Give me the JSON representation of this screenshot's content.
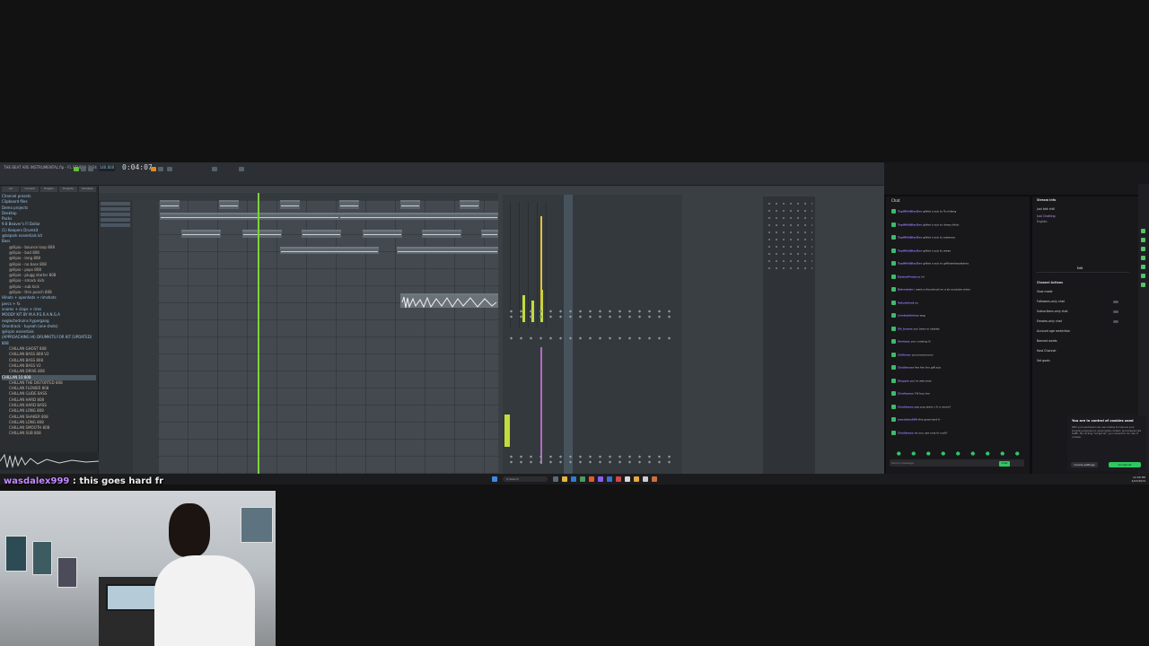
{
  "fl_studio": {
    "title": "THE BEAT ARE INSTRUMENTAL.flp - FL STUDIO 2024",
    "time": "0:04:07",
    "bpm": "140.000",
    "browser_tabs": [
      "All",
      "Current",
      "Plugins",
      "Projects",
      "Samples"
    ],
    "browser_items": [
      {
        "label": "Channel presets",
        "kind": "folder"
      },
      {
        "label": "Clipboard files",
        "kind": "folder"
      },
      {
        "label": "Demo projects",
        "kind": "folder"
      },
      {
        "label": "Desktop",
        "kind": "folder"
      },
      {
        "label": "Packs",
        "kind": "folder"
      },
      {
        "label": "9.8 Beaver's Fl Dollar",
        "kind": "folder"
      },
      {
        "label": "(1) Keepers Drumkit",
        "kind": "folder"
      },
      {
        "label": "@lolpark essentials kit",
        "kind": "folder"
      },
      {
        "label": "Bass",
        "kind": "folder"
      },
      {
        "label": "@lilpio - bounce loop 808",
        "kind": "sub"
      },
      {
        "label": "@lilpio - bad 808",
        "kind": "sub"
      },
      {
        "label": "@lilpio - long 808",
        "kind": "sub"
      },
      {
        "label": "@lilpio - no bass 808",
        "kind": "sub"
      },
      {
        "label": "@lilpio - pops 808",
        "kind": "sub"
      },
      {
        "label": "@lilpio - plugg starter 808",
        "kind": "sub"
      },
      {
        "label": "@lilpio - smack kick",
        "kind": "sub"
      },
      {
        "label": "@lilpio - sub kick",
        "kind": "sub"
      },
      {
        "label": "@lilpio - thin punch 808",
        "kind": "sub"
      },
      {
        "label": "Hihats + openhats + rimshots",
        "kind": "folder"
      },
      {
        "label": "percs + fx",
        "kind": "folder"
      },
      {
        "label": "snares + claps + rims",
        "kind": "folder"
      },
      {
        "label": "MOODY KIT BY M.A.P.S.R.A.N.G.A",
        "kind": "folder"
      },
      {
        "label": "neglectedruins hypergang",
        "kind": "folder"
      },
      {
        "label": "Omnitrack - tuyeah (one shots)",
        "kind": "folder"
      },
      {
        "label": "@ilspin essentials",
        "kind": "folder"
      },
      {
        "label": "(APPROACHING HI) DRUMKITS FOR KIT [UPDATED]",
        "kind": "folder"
      },
      {
        "label": "808",
        "kind": "folder"
      },
      {
        "label": "CHILLAN GHOST 808",
        "kind": "sub"
      },
      {
        "label": "CHILLAN BASS 808 V2",
        "kind": "sub"
      },
      {
        "label": "CHILLAN BASS 808",
        "kind": "sub"
      },
      {
        "label": "CHILLAN BASS V2",
        "kind": "sub"
      },
      {
        "label": "CHILLAN DRIVE 808",
        "kind": "sub"
      },
      {
        "label": "CHILLAN 10 808",
        "kind": "hl"
      },
      {
        "label": "CHILLAN THE DISTORTED 808",
        "kind": "sub"
      },
      {
        "label": "CHILLAN FLOWER 808",
        "kind": "sub"
      },
      {
        "label": "CHILLAN GLIDE BASS",
        "kind": "sub"
      },
      {
        "label": "CHILLAN HARD 808",
        "kind": "sub"
      },
      {
        "label": "CHILLAN HARD BASS",
        "kind": "sub"
      },
      {
        "label": "CHILLAN LONG 808",
        "kind": "sub"
      },
      {
        "label": "CHILLAN SHAKER 808",
        "kind": "sub"
      },
      {
        "label": "CHILLAN LONG 808",
        "kind": "sub"
      },
      {
        "label": "CHILLAN SMOOTH 808",
        "kind": "sub"
      },
      {
        "label": "CHILLAN SUB 808",
        "kind": "sub"
      }
    ]
  },
  "twitch": {
    "chat_title": "Chat",
    "messages": [
      {
        "user": "TopWithBlacDev",
        "text": "gifted a sub to Tuchilang"
      },
      {
        "user": "TopWithBlacDev",
        "text": "gifted a sub to dmsuchkdo"
      },
      {
        "user": "TopWithBlacDev",
        "text": "gifted a sub to justwrya"
      },
      {
        "user": "TopWithBlacDev",
        "text": "gifted a sub to weee"
      },
      {
        "user": "TopWithBlacDev",
        "text": "gifted a sub to gifthisedassistants"
      },
      {
        "user": "DylansProduce",
        "text": "lol"
      },
      {
        "user": "Bahndrain",
        "text": "i want a thumbnail on a sh youtube video"
      },
      {
        "user": "Valueblunt",
        "text": "yo"
      },
      {
        "user": "Livebubblelux",
        "text": "wsg"
      },
      {
        "user": "Oh_bonne",
        "text": "you been in labbbb"
      },
      {
        "user": "Ventnav",
        "text": "you cooking lil"
      },
      {
        "user": "Chillsvar",
        "text": "yoooooooooooo"
      },
      {
        "user": "Chullanoar",
        "text": "the fan trio gift sub"
      },
      {
        "user": "Sluppin",
        "text": "you're welcome"
      },
      {
        "user": "Chullamax",
        "text": "YW boy bro"
      },
      {
        "user": "Chullamax",
        "text": "pop pop were u fr a neuro?"
      },
      {
        "user": "wasdalex999",
        "text": "this goes hard fr"
      },
      {
        "user": "Chullamax",
        "text": "do you use only to rush?"
      }
    ],
    "input_placeholder": "Send a message",
    "chat_button": "Chat",
    "info": {
      "title": "Stream Info",
      "subtitle": "just talk chill",
      "category": "Just Chatting",
      "tag": "English",
      "edit_label": "Edit",
      "actions_title": "Channel Actions",
      "actions": [
        "Slow mode",
        "Followers-only chat",
        "Subscribers-only chat",
        "Emotes-only chat",
        "Account age restriction",
        "Banned words",
        "Host Channel",
        "Set goals"
      ]
    },
    "cookie": {
      "title": "You are in control of cookies used",
      "body": "With your permission we use cookies to improve your browsing experience, personalize content, and analyze site traffic. By clicking \"Accept all\", you consent to our use of cookies.",
      "settings_label": "Cookie settings",
      "accept_label": "Accept all"
    }
  },
  "taskbar": {
    "search": "Q Search",
    "clock_time": "12:09 PM",
    "clock_date": "4/23/2024"
  },
  "overlay": {
    "user": "wasdalex999",
    "message": " : this goes hard fr"
  }
}
